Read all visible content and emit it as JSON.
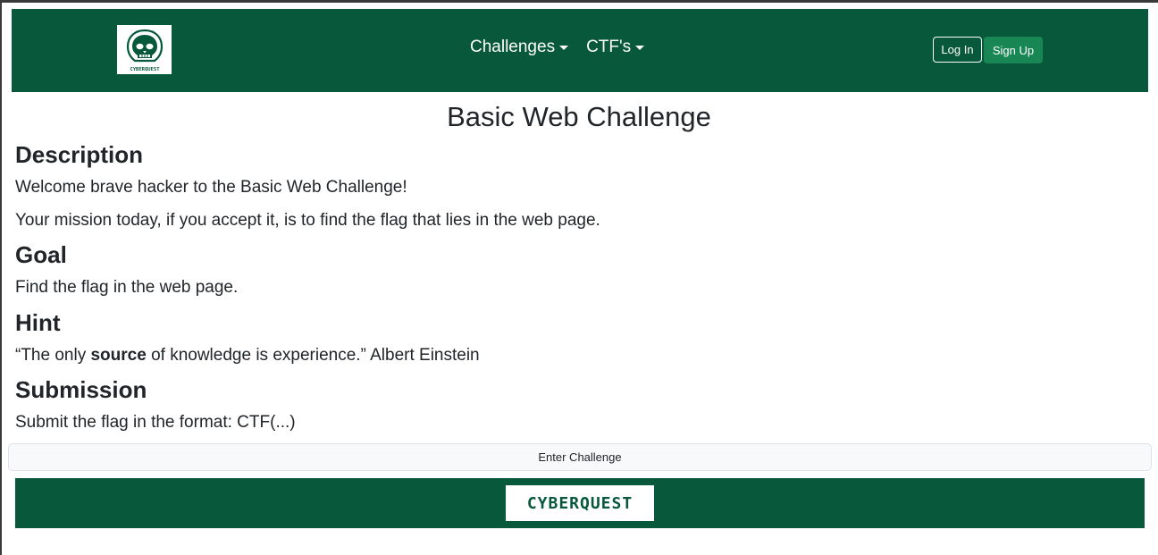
{
  "nav": {
    "logo_text": "CYBERQUEST",
    "links": [
      {
        "label": "Challenges"
      },
      {
        "label": "CTF's"
      }
    ],
    "login_label": "Log In",
    "signup_label": "Sign Up"
  },
  "main": {
    "title": "Basic Web Challenge",
    "description": {
      "heading": "Description",
      "paragraph1": "Welcome brave hacker to the Basic Web Challenge!",
      "paragraph2": "Your mission today, if you accept it, is to find the flag that lies in the web page."
    },
    "goal": {
      "heading": "Goal",
      "text": "Find the flag in the web page."
    },
    "hint": {
      "heading": "Hint",
      "quote_start": "“The only ",
      "quote_bold": "source",
      "quote_end": " of knowledge is experience.” Albert Einstein"
    },
    "submission": {
      "heading": "Submission",
      "text": "Submit the flag in the format: CTF(...)"
    },
    "enter_button": "Enter Challenge"
  },
  "footer": {
    "logo_text": "CYBERQUEST"
  },
  "colors": {
    "brand_green": "#08583b",
    "signup_green": "#198754"
  }
}
